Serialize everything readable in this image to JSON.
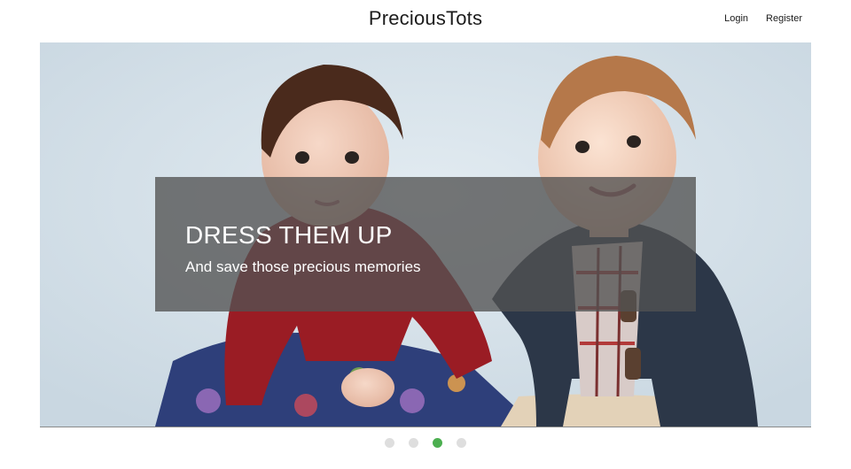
{
  "header": {
    "brand": "PreciousTots",
    "nav": [
      {
        "label": "Login"
      },
      {
        "label": "Register"
      }
    ]
  },
  "hero": {
    "title": "DRESS THEM UP",
    "subtitle": "And save those precious memories",
    "image": "two toddlers in red velvet dress and navy cardigan"
  },
  "carousel": {
    "slide_count": 4,
    "active_slide": 3
  },
  "colors": {
    "accent": "#4caf50",
    "dot_inactive": "#dedede",
    "hero_bg": "#d5e1ea",
    "caption_overlay": "#525252"
  }
}
